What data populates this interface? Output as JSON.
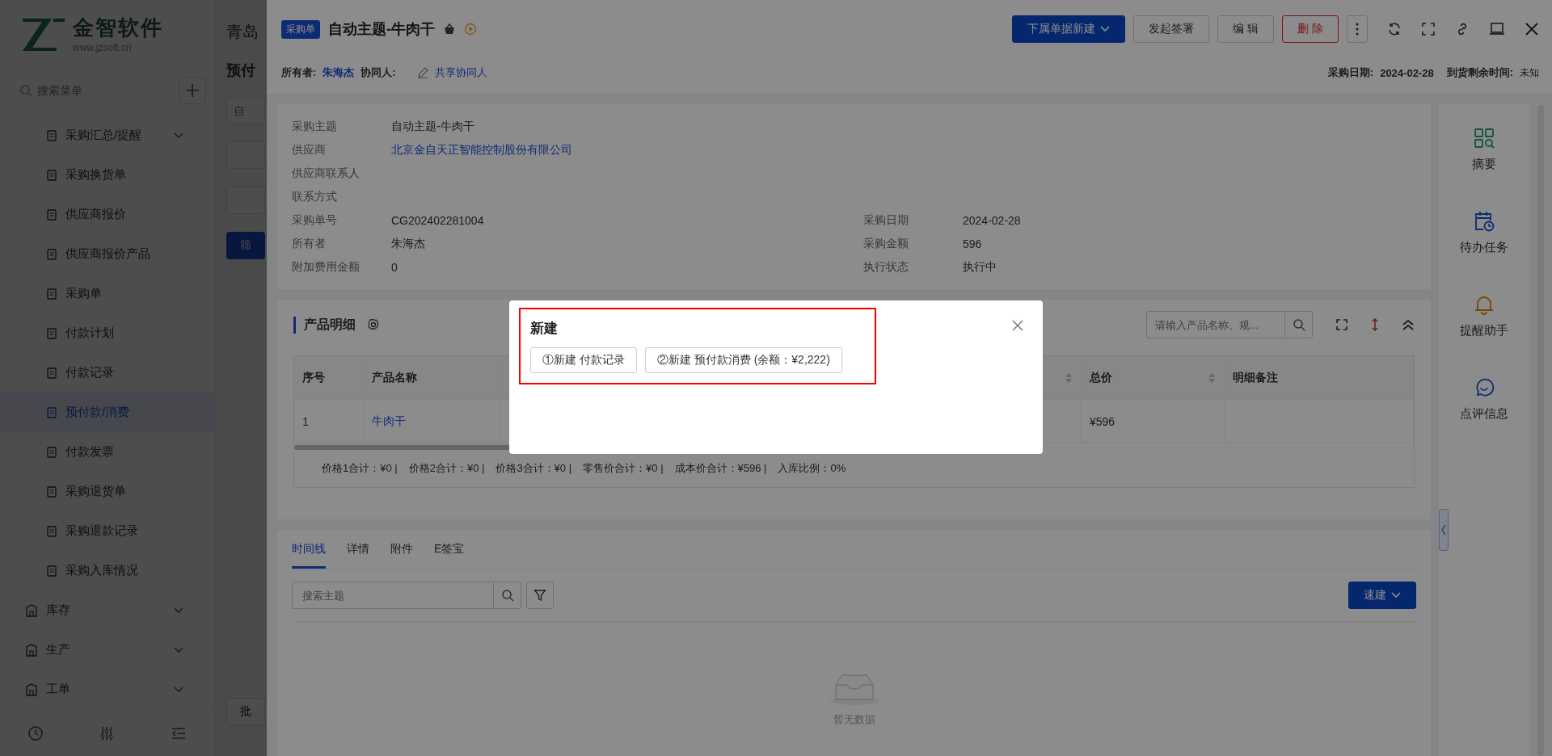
{
  "app": {
    "logo": {
      "name": "金智软件",
      "url": "www.jzsoft.cn"
    },
    "company": "青岛",
    "page_title": "预付",
    "search": {
      "placeholder": "搜索菜单"
    },
    "menu": [
      {
        "label": "采购汇总/提醒",
        "kind": "sub",
        "expandable": true,
        "selected": false
      },
      {
        "label": "采购换货单",
        "kind": "sub",
        "expandable": false,
        "selected": false
      },
      {
        "label": "供应商报价",
        "kind": "sub",
        "expandable": false,
        "selected": false
      },
      {
        "label": "供应商报价产品",
        "kind": "sub",
        "expandable": false,
        "selected": false
      },
      {
        "label": "采购单",
        "kind": "sub",
        "expandable": false,
        "selected": false
      },
      {
        "label": "付款计划",
        "kind": "sub",
        "expandable": false,
        "selected": false
      },
      {
        "label": "付款记录",
        "kind": "sub",
        "expandable": false,
        "selected": false
      },
      {
        "label": "预付款/消费",
        "kind": "sub",
        "expandable": false,
        "selected": true
      },
      {
        "label": "付款发票",
        "kind": "sub",
        "expandable": false,
        "selected": false
      },
      {
        "label": "采购退货单",
        "kind": "sub",
        "expandable": false,
        "selected": false
      },
      {
        "label": "采购退款记录",
        "kind": "sub",
        "expandable": false,
        "selected": false
      },
      {
        "label": "采购入库情况",
        "kind": "sub",
        "expandable": false,
        "selected": false
      },
      {
        "label": "库存",
        "kind": "group",
        "expandable": true,
        "selected": false
      },
      {
        "label": "生产",
        "kind": "group",
        "expandable": true,
        "selected": false
      },
      {
        "label": "工单",
        "kind": "group",
        "expandable": true,
        "selected": false
      }
    ],
    "filter_placeholder": "自",
    "filter_button": "筛",
    "batch_button": "批"
  },
  "drawer": {
    "tag": "采购单",
    "title": "自动主题-牛肉干",
    "actions": [
      {
        "label": "下属单据新建",
        "kind": "primary"
      },
      {
        "label": "发起签署",
        "kind": "default"
      },
      {
        "label": "编 辑",
        "kind": "default"
      },
      {
        "label": "删 除",
        "kind": "danger"
      }
    ],
    "owner_label": "所有者:",
    "owner": "朱海杰",
    "collab_label": "协同人:",
    "share_link": "共享协同人",
    "date_label": "采购日期:",
    "date": "2024-02-28",
    "remain_label": "到货剩余时间:",
    "remain": "未知",
    "fields": [
      [
        {
          "label": "采购主题",
          "value": "自动主题-牛肉干",
          "link": false
        }
      ],
      [
        {
          "label": "供应商",
          "value": "北京金自天正智能控制股份有限公司",
          "link": true
        }
      ],
      [
        {
          "label": "供应商联系人"
        }
      ],
      [
        {
          "label": "联系方式"
        }
      ],
      [
        {
          "label": "采购单号",
          "value": "CG202402281004",
          "link": false
        },
        {
          "label": "采购日期",
          "value": "2024-02-28",
          "link": false
        }
      ],
      [
        {
          "label": "所有者",
          "value": "朱海杰",
          "link": false
        },
        {
          "label": "采购金额",
          "value": "596",
          "link": false
        }
      ],
      [
        {
          "label": "附加费用金额",
          "value": "0",
          "link": false
        },
        {
          "label": "执行状态",
          "value": "执行中",
          "link": false
        }
      ]
    ],
    "products": {
      "title": "产品明细",
      "search_placeholder": "请输入产品名称、规...",
      "columns": [
        {
          "label": "序号",
          "sortable": false
        },
        {
          "label": "产品名称",
          "sortable": false
        },
        {
          "sortable": true
        },
        {
          "label": "总价",
          "sortable": true
        },
        {
          "label": "明细备注",
          "sortable": false
        }
      ],
      "rows": [
        {
          "index": "1",
          "product": "牛肉干",
          "total": "¥596"
        }
      ],
      "totals": [
        "价格1合计：¥0 |",
        "价格2合计：¥0 |",
        "价格3合计：¥0 |",
        "零售价合计：¥0 |",
        "成本价合计：¥596 |",
        "入库比例：0%"
      ]
    },
    "timeline": {
      "tabs": [
        {
          "label": "时间线",
          "selected": true
        },
        {
          "label": "详情",
          "selected": false
        },
        {
          "label": "附件",
          "selected": false
        },
        {
          "label": "E签宝",
          "selected": false
        }
      ],
      "search_placeholder": "搜索主题",
      "quick_button": "速建",
      "empty": "暂无数据"
    },
    "rail": [
      {
        "label": "摘要",
        "kind": "summary"
      },
      {
        "label": "待办任务",
        "kind": "todo"
      },
      {
        "label": "提醒助手",
        "kind": "remind"
      },
      {
        "label": "点评信息",
        "kind": "comment"
      }
    ]
  },
  "dialog": {
    "title": "新建",
    "highlighted": true,
    "buttons": [
      "①新建 付款记录",
      "②新建 预付款消费 (余额：¥2,222)"
    ]
  }
}
